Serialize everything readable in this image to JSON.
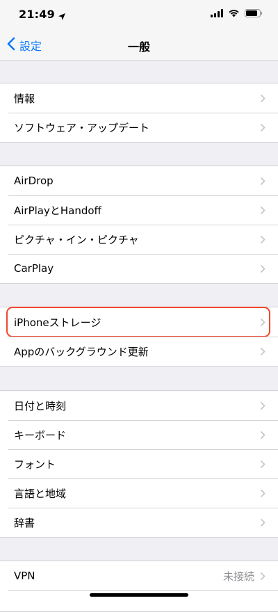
{
  "status_bar": {
    "time": "21:49",
    "location_icon": "location-arrow-icon",
    "signal_icon": "cellular-signal-icon",
    "wifi_icon": "wifi-icon",
    "battery_icon": "battery-icon"
  },
  "nav": {
    "back_label": "設定",
    "title": "一般",
    "accent_color": "#0a7aff"
  },
  "groups": [
    {
      "rows": [
        {
          "label": "情報"
        },
        {
          "label": "ソフトウェア・アップデート"
        }
      ]
    },
    {
      "rows": [
        {
          "label": "AirDrop"
        },
        {
          "label": "AirPlayとHandoff"
        },
        {
          "label": "ピクチャ・イン・ピクチャ"
        },
        {
          "label": "CarPlay"
        }
      ]
    },
    {
      "rows": [
        {
          "label": "iPhoneストレージ",
          "highlighted": true
        },
        {
          "label": "Appのバックグラウンド更新"
        }
      ]
    },
    {
      "rows": [
        {
          "label": "日付と時刻"
        },
        {
          "label": "キーボード"
        },
        {
          "label": "フォント"
        },
        {
          "label": "言語と地域"
        },
        {
          "label": "辞書"
        }
      ]
    },
    {
      "rows": [
        {
          "label": "VPN",
          "value": "未接続"
        }
      ]
    }
  ],
  "highlight_color": "#ef4930"
}
